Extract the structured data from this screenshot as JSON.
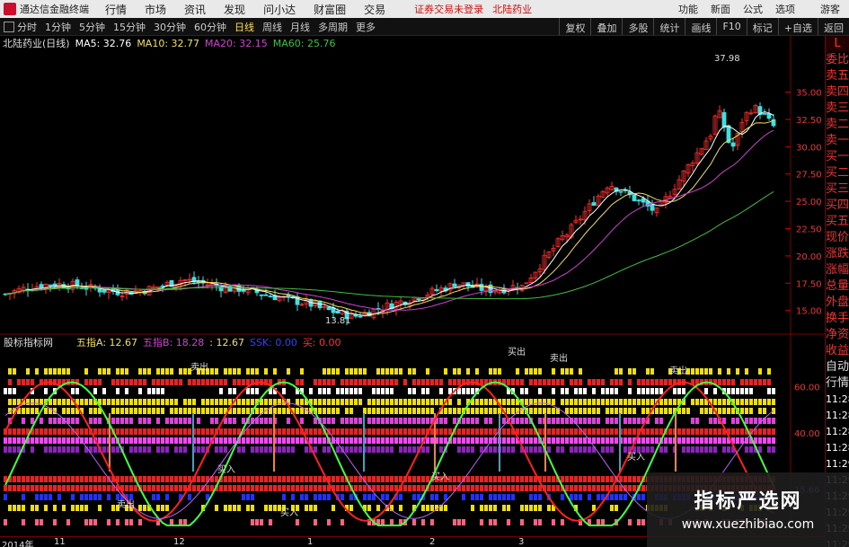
{
  "menubar": {
    "app_title": "通达信金融终端",
    "items": [
      "行情",
      "市场",
      "资讯",
      "发现",
      "问小达",
      "财富圈",
      "交易"
    ],
    "warning": "证券交易未登录",
    "stock": "北陆药业",
    "right_items": [
      "功能",
      "新面",
      "公式",
      "选项"
    ],
    "guest": "游客"
  },
  "toolbar": {
    "periods": [
      "分时",
      "1分钟",
      "5分钟",
      "15分钟",
      "30分钟",
      "60分钟",
      "日线",
      "周线",
      "月线",
      "多周期",
      "更多"
    ],
    "active_period": "日线",
    "right": [
      "复权",
      "叠加",
      "多股",
      "统计",
      "画线",
      "F10",
      "标记",
      "+自选",
      "返回"
    ]
  },
  "chart_info": {
    "title": "北陆药业(日线)",
    "ma5": "MA5: 32.76",
    "ma10": "MA10: 32.77",
    "ma20": "MA20: 32.15",
    "ma60": "MA60: 25.76",
    "high_label": "37.98",
    "low_label": "13.81"
  },
  "colors": {
    "ma5": "#ffffff",
    "ma10": "#f0e060",
    "ma20": "#d040d0",
    "ma60": "#40c040",
    "up": "#ff3030",
    "down": "#40e0e0"
  },
  "price_axis": [
    "35.00",
    "32.50",
    "30.00",
    "27.50",
    "25.00",
    "22.50",
    "20.00",
    "17.50",
    "15.00"
  ],
  "indicator_info": {
    "name": "股标指标网",
    "a": "五指A: 12.67",
    "b": "五指B: 18.28",
    "c": ": 12.67",
    "ssk": "SSK: 0.00",
    "buy": "买: 0.00"
  },
  "indicator_axis": [
    "60.00",
    "40.00",
    "15.66"
  ],
  "signals": [
    "卖出",
    "买入",
    "买出",
    "卖出",
    "买入",
    "买入",
    "卖出",
    "买入",
    "卖出"
  ],
  "sidebar": {
    "top": "L",
    "items": [
      "委比",
      "卖五",
      "卖四",
      "卖三",
      "卖二",
      "卖一",
      "买一",
      "买二",
      "买三",
      "买四",
      "买五",
      "现价",
      "涨跌",
      "涨幅",
      "总量",
      "外盘",
      "换手",
      "净资",
      "收益",
      "自动",
      "行情",
      "11:28",
      "11:28",
      "11:28",
      "11:28",
      "11:29",
      "11:29",
      "11:29",
      "11:29",
      "11:29",
      "11:29"
    ]
  },
  "bottom_axis": [
    "2014年",
    "11",
    "12",
    "1",
    "2",
    "3"
  ],
  "watermark": {
    "line1": "指标严选网",
    "line2": "www.xuezhibiao.com"
  }
}
